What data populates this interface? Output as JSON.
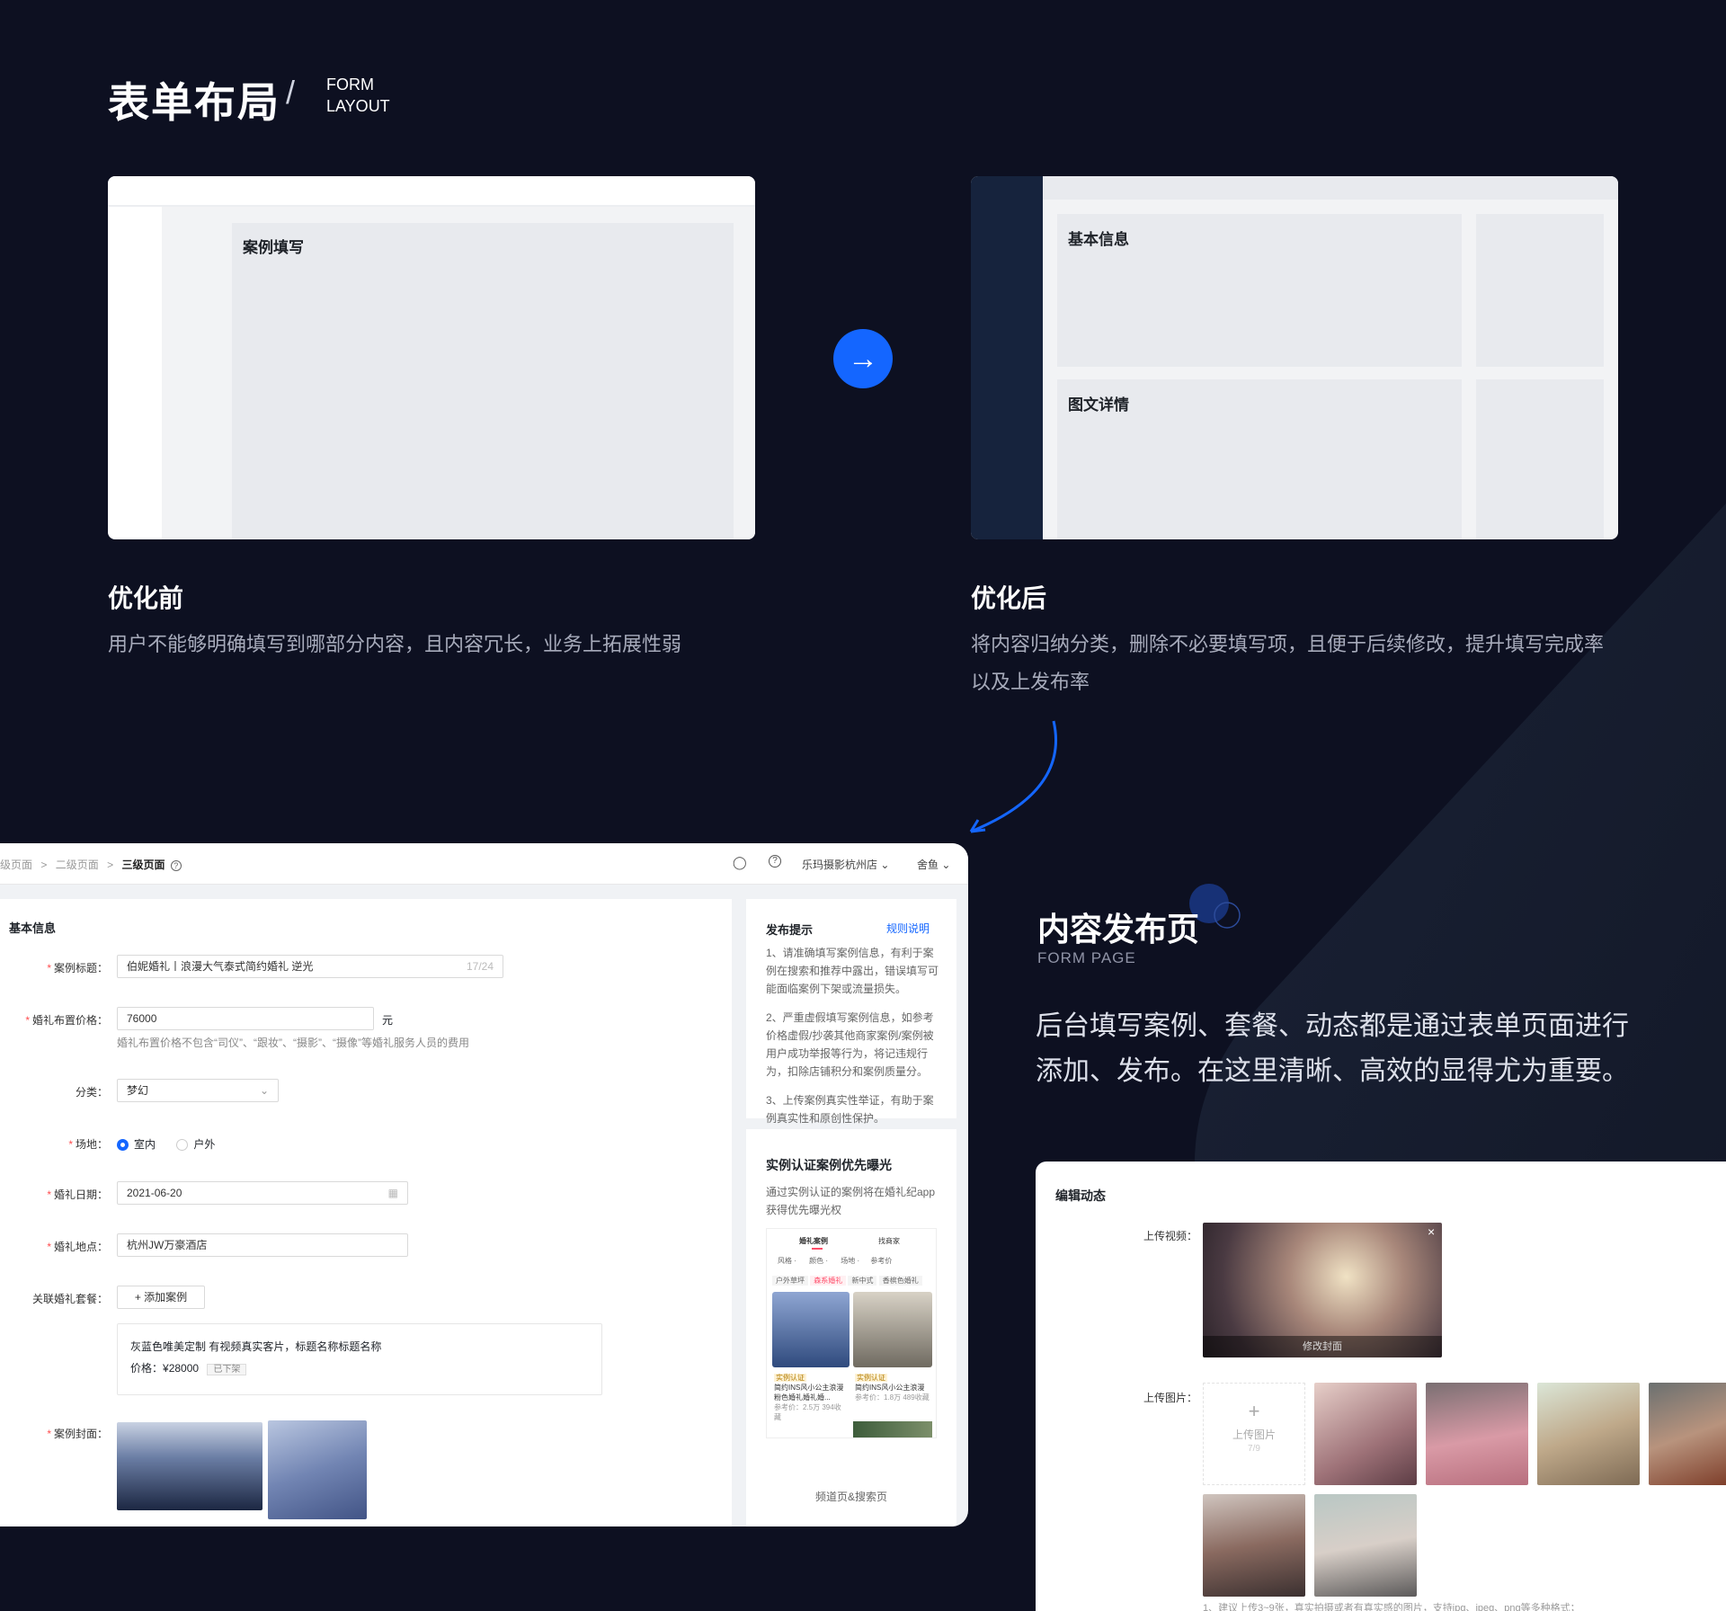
{
  "header": {
    "title": "表单布局",
    "slash": "/",
    "en_line1": "FORM",
    "en_line2": "LAYOUT"
  },
  "before": {
    "card_label": "案例填写",
    "title": "优化前",
    "desc": "用户不能够明确填写到哪部分内容，且内容冗长，业务上拓展性弱"
  },
  "after": {
    "card_label1": "基本信息",
    "card_label2": "图文详情",
    "title": "优化后",
    "desc_line1": "将内容归纳分类，删除不必要填写项，且便于后续修改，提升填写完成率",
    "desc_line2": "以及上发布率"
  },
  "arrow_glyph": "→",
  "form": {
    "breadcrumb": {
      "item1": "级页面",
      "item2": "二级页面",
      "item3": "三级页面",
      "sep": ">"
    },
    "topbar": {
      "store": "乐玛摄影杭州店",
      "user": "舍鱼"
    },
    "section_title": "基本信息",
    "fields": {
      "case_title_label": "案例标题：",
      "case_title_value": "伯妮婚礼丨浪漫大气泰式简约婚礼 逆光",
      "case_title_count": "17/24",
      "price_label": "婚礼布置价格：",
      "price_value": "76000",
      "price_unit": "元",
      "price_hint": "婚礼布置价格不包含“司仪”、“跟妆”、“摄影”、“摄像”等婚礼服务人员的费用",
      "category_label": "分类：",
      "category_value": "梦幻",
      "venue_label": "场地：",
      "venue_opt1": "室内",
      "venue_opt2": "户外",
      "date_label": "婚礼日期：",
      "date_value": "2021-06-20",
      "place_label": "婚礼地点：",
      "place_value": "杭州JW万豪酒店",
      "package_label": "关联婚礼套餐：",
      "add_case_btn": "+ 添加案例",
      "package_name": "灰蓝色唯美定制 有视频真实客片，标题名称标题名称",
      "package_price_label": "价格：",
      "package_price": "¥28000",
      "package_status": "已下架",
      "cover_label": "案例封面："
    },
    "tips": {
      "title": "发布提示",
      "link": "规则说明",
      "p1": "1、请准确填写案例信息，有利于案例在搜索和推荐中露出，错误填写可能面临案例下架或流量损失。",
      "p2": "2、严重虚假填写案例信息，如参考价格虚假/抄袭其他商家案例/案例被用户成功举报等行为，将记违规行为，扣除店铺积分和案例质量分。",
      "p3": "3、上传案例真实性举证，有助于案例真实性和原创性保护。"
    },
    "cert": {
      "title": "实例认证案例优先曝光",
      "desc": "通过实例认证的案例将在婚礼纪app获得优先曝光权",
      "footer": "频道页&搜索页",
      "phone": {
        "tab1": "婚礼案例",
        "tab2": "找商家",
        "filter1": "风格",
        "filter2": "颜色",
        "filter3": "场地",
        "filter4": "参考价",
        "chip1": "户外草坪",
        "chip2": "森系婚礼",
        "chip3": "新中式",
        "chip4": "香槟色婚礼",
        "badge": "实例认证",
        "card_title1": "简约INS风小公主浪漫粉色婚礼婚礼婚...",
        "card_title2": "简约INS风小公主浪漫",
        "price1": "参考价：2.5万",
        "price2": "参考价：1.8万",
        "count1": "394收藏",
        "count2": "489收藏"
      }
    }
  },
  "content_page": {
    "title": "内容发布页",
    "en": "FORM PAGE",
    "desc_line1": "后台填写案例、套餐、动态都是通过表单页面进行",
    "desc_line2": "添加、发布。在这里清晰、高效的显得尤为重要。"
  },
  "edit": {
    "title": "编辑动态",
    "video_label": "上传视频：",
    "video_cover_btn": "修改封面",
    "close": "×",
    "image_label": "上传图片：",
    "upload_btn": "上传图片",
    "upload_count": "7/9",
    "footnote": "1、建议上传3~9张，真实拍摄或者有真实感的图片，支持jpg、jpeg、png等多种格式；"
  },
  "colors": {
    "bg": "#0d1021",
    "accent": "#1466ff",
    "sidebar": "#16233d"
  }
}
